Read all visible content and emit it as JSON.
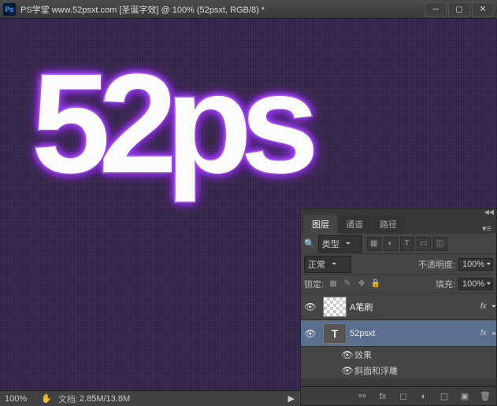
{
  "titlebar": {
    "logo": "Ps",
    "title": "PS学堂 www.52psxt.com [圣诞字效] @ 100% (52psxt, RGB/8) *"
  },
  "canvas": {
    "text": "52ps"
  },
  "footer": {
    "zoom": "100%",
    "doc_label": "文档:",
    "doc_size": "2.85M/13.8M"
  },
  "panel": {
    "tabs": {
      "layers": "图层",
      "channels": "通道",
      "paths": "路径"
    },
    "filter_kind": "类型",
    "blend_mode": "正常",
    "opacity_label": "不透明度:",
    "opacity": "100%",
    "lock_label": "锁定:",
    "fill_label": "填充:",
    "fill": "100%",
    "layers": [
      {
        "name": "A笔刷",
        "fx": "fx"
      },
      {
        "name": "52psxt",
        "fx": "fx"
      }
    ],
    "effects_label": "效果",
    "effect_item": "斜面和浮雕"
  }
}
